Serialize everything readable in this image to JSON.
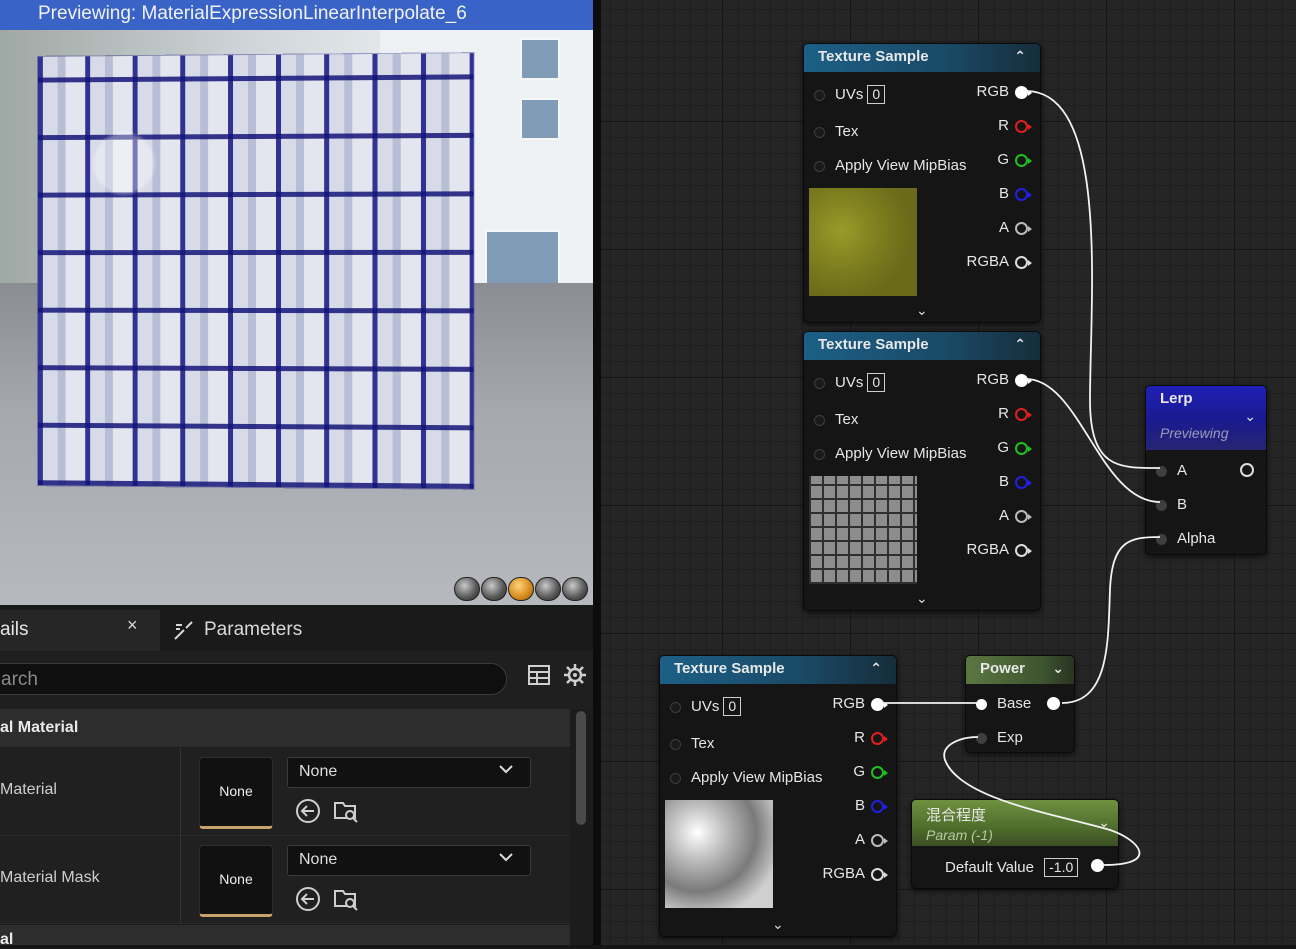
{
  "viewport": {
    "title": "Previewing: MaterialExpressionLinearInterpolate_6",
    "shape_buttons": [
      "cylinder",
      "sphere",
      "plane",
      "cube",
      "custom-mesh"
    ],
    "active_shape": "plane"
  },
  "details_panel": {
    "tab_details_label": "ails",
    "tab_close_label": "×",
    "tab_parameters_label": "Parameters",
    "search_placeholder": "arch",
    "section_material": "al Material",
    "section_bottom": "al",
    "properties": [
      {
        "label": "Material",
        "thumb": "None",
        "combo_value": "None"
      },
      {
        "label": "Material Mask",
        "thumb": "None",
        "combo_value": "None"
      }
    ]
  },
  "graph": {
    "texture_nodes": [
      {
        "title": "Texture Sample",
        "uvs_label": "UVs",
        "uvs_value": "0",
        "tex_label": "Tex",
        "mip_label": "Apply View MipBias",
        "outputs": [
          "RGB",
          "R",
          "G",
          "B",
          "A",
          "RGBA"
        ],
        "preview": "mossy-green-texture"
      },
      {
        "title": "Texture Sample",
        "uvs_label": "UVs",
        "uvs_value": "0",
        "tex_label": "Tex",
        "mip_label": "Apply View MipBias",
        "outputs": [
          "RGB",
          "R",
          "G",
          "B",
          "A",
          "RGBA"
        ],
        "preview": "cobblestone-texture"
      },
      {
        "title": "Texture Sample",
        "uvs_label": "UVs",
        "uvs_value": "0",
        "tex_label": "Tex",
        "mip_label": "Apply View MipBias",
        "outputs": [
          "RGB",
          "R",
          "G",
          "B",
          "A",
          "RGBA"
        ],
        "preview": "gray-noise-texture"
      }
    ],
    "lerp_node": {
      "title": "Lerp",
      "status": "Previewing",
      "inputs": [
        "A",
        "B",
        "Alpha"
      ]
    },
    "power_node": {
      "title": "Power",
      "inputs": [
        "Base",
        "Exp"
      ]
    },
    "param_node": {
      "title": "混合程度",
      "subtitle": "Param (-1)",
      "default_label": "Default Value",
      "default_value": "-1.0"
    },
    "colors": {
      "red_pin": "#e02020",
      "green_pin": "#20c020",
      "blue_pin": "#2020e0",
      "white_pin": "#ffffff",
      "header_blue": "#1c5f86",
      "lerp_header": "#1d1d9e",
      "param_header": "#5d7f35"
    }
  }
}
